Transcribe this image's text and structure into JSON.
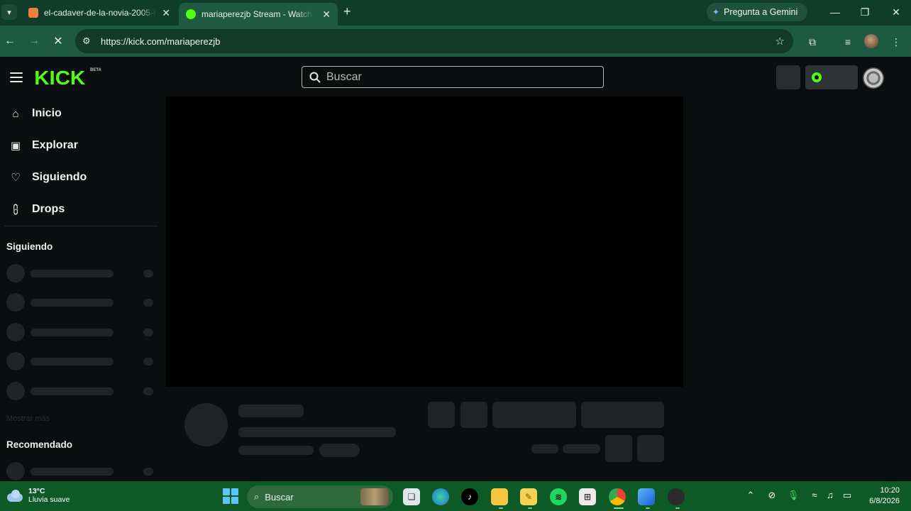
{
  "browser": {
    "tabs": [
      {
        "title": "el-cadaver-de-la-novia-2005-La",
        "favicon_color": "#f0803c"
      },
      {
        "title": "mariaperezjb Stream - Watch Li",
        "favicon_color": "#53fc18",
        "active": true
      }
    ],
    "tab_list_icon": "chevron-down",
    "new_tab_icon": "+",
    "gemini_label": "Pregunta a Gemini",
    "url": "https://kick.com/mariaperezjb",
    "window_controls": [
      "minimize",
      "restore",
      "close"
    ]
  },
  "kick": {
    "logo": "KICK",
    "beta": "BETA",
    "brand_color": "#53fc18",
    "search_placeholder": "Buscar",
    "nav": [
      {
        "label": "Inicio",
        "icon": "home-icon"
      },
      {
        "label": "Explorar",
        "icon": "explore-icon"
      },
      {
        "label": "Siguiendo",
        "icon": "heart-icon"
      },
      {
        "label": "Drops",
        "icon": "drops-icon"
      }
    ],
    "section_following": "Siguiendo",
    "show_more": "Mostrar más",
    "section_recommended": "Recomendado"
  },
  "taskbar": {
    "temperature": "13°C",
    "weather": "Lluvia suave",
    "search_label": "Buscar",
    "time": "10:20",
    "date": "6/8/2026"
  }
}
